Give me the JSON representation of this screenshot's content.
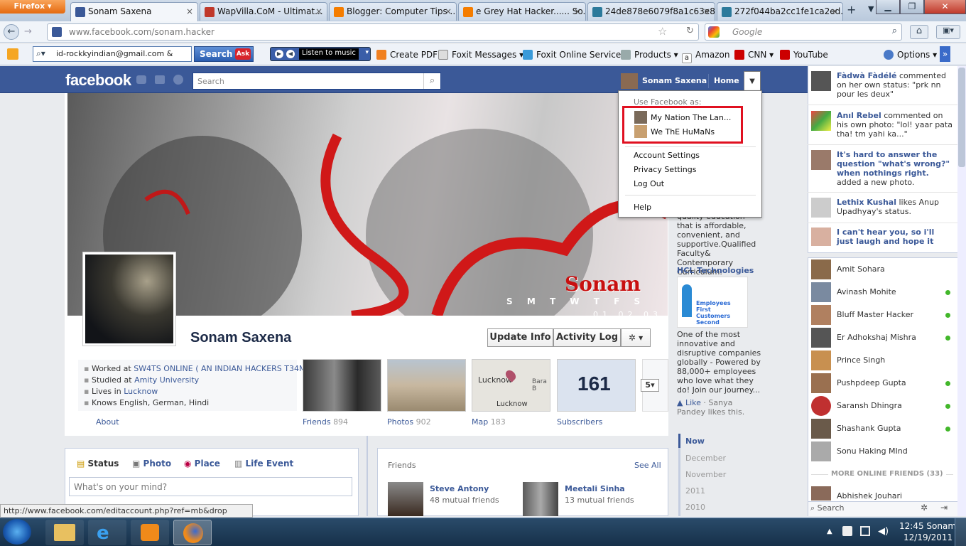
{
  "browser": {
    "menu_label": "Firefox",
    "tabs": [
      {
        "title": "Sonam Saxena",
        "active": true
      },
      {
        "title": "WapVilla.CoM - Ultimat..."
      },
      {
        "title": "Blogger: Computer Tips ..."
      },
      {
        "title": "e Grey Hat Hacker...... So..."
      },
      {
        "title": "24de878e6079f8a1c63e8..."
      },
      {
        "title": "272f044ba2cc1fe1ca2ed..."
      }
    ],
    "new_tab": "+",
    "url": "www.facebook.com/sonam.hacker",
    "search_placeholder": "Google",
    "toolbar_email": "id-rockkyindian@gmail.com &",
    "search_button": "Search",
    "listen_label": "Listen to music",
    "bookmarks": [
      "Create PDF",
      "Foxit Messages",
      "Foxit Online Services",
      "Products",
      "Amazon",
      "CNN",
      "YouTube"
    ],
    "options_label": "Options",
    "status_url": "http://www.facebook.com/editaccount.php?ref=mb&drop"
  },
  "fb": {
    "logo": "facebook",
    "search_placeholder": "Search",
    "user_name": "Sonam Saxena",
    "home_label": "Home",
    "dropdown": {
      "heading": "Use Facebook as:",
      "pages": [
        "My Nation The Lan...",
        "We ThE HuMaNs"
      ],
      "items": [
        "Account Settings",
        "Privacy Settings",
        "Log Out"
      ],
      "help": "Help"
    }
  },
  "profile": {
    "name": "Sonam Saxena",
    "cover_text": "Sonam",
    "calendar_days": "S M T W T F S",
    "calendar_dates": "01 02 03",
    "update_info": "Update Info",
    "activity_log": "Activity Log",
    "info": {
      "work_prefix": "Worked at ",
      "work": "SW4TS ONLINE ( AN INDIAN HACKERS T34M )",
      "study_prefix": "Studied at ",
      "study": "Amity University",
      "lives_prefix": "Lives in ",
      "lives": "Lucknow",
      "knows": "Knows English, German, Hindi"
    },
    "about": "About",
    "tiles": {
      "friends_label": "Friends",
      "friends_count": "894",
      "photos_label": "Photos",
      "photos_count": "902",
      "map_label": "Map",
      "map_count": "183",
      "subs_label": "Subscribers",
      "subs_count": "161",
      "map_city": "Lucknow",
      "map_city2": "Lucknow",
      "map_place": "Bara B",
      "more": "5"
    },
    "composer": {
      "status": "Status",
      "photo": "Photo",
      "place": "Place",
      "life_event": "Life Event",
      "placeholder": "What's on your mind?"
    },
    "friends_box": {
      "title": "Friends",
      "see_all": "See All",
      "friends": [
        {
          "name": "Steve Antony",
          "mutual": "48 mutual friends"
        },
        {
          "name": "Meetali Sinha",
          "mutual": "13 mutual friends"
        }
      ]
    }
  },
  "rail": {
    "ad1_text": "quality education that is affordable, convenient, and supportive.Qualified Faculty& Contemporary Curriculum.",
    "ad2_title": "HCL Technologies",
    "ad2_image_text": "Employees First Customers Second",
    "ad2_text": "One of the most innovative and disruptive companies globally - Powered by 88,000+ employees who love what they do! Join our journey...",
    "like": "Like",
    "like_suffix": " · Sanya Pandey likes this.",
    "timeline": [
      "Now",
      "December",
      "November",
      "2011",
      "2010"
    ]
  },
  "ticker": {
    "stories": [
      {
        "actor": "Fàdwà Fàdélé",
        "text": " commented on her own status: \"prk nn pour les deux\""
      },
      {
        "actor": "Anıl Rebel",
        "text": " commented on his own photo: \"lol! yaar pata tha! tm yahi ka...\""
      },
      {
        "actor": "It's hard to answer the question \"what's wrong?\" when nothings right.",
        "text": " added a new photo."
      },
      {
        "actor": "Lethix Kushal",
        "text": " likes Anup Upadhyay's status."
      },
      {
        "actor": "I can't hear you, so i'll just laugh and hope it wasn't a",
        "text": ""
      }
    ],
    "chat": [
      {
        "name": "Amit Sohara",
        "online": false
      },
      {
        "name": "Avinash Mohite",
        "online": true
      },
      {
        "name": "Bluff Master Hacker",
        "online": true
      },
      {
        "name": "Er Adhokshaj Mishra",
        "online": true
      },
      {
        "name": "Prince Singh",
        "online": false
      },
      {
        "name": "Pushpdeep Gupta",
        "online": true
      },
      {
        "name": "Saransh Dhingra",
        "online": true
      },
      {
        "name": "Shashank Gupta",
        "online": true
      },
      {
        "name": "Sonu Haking MInd",
        "online": false
      }
    ],
    "more_online": "MORE ONLINE FRIENDS (33)",
    "last_friend": "Abhishek Jouhari",
    "search_placeholder": "Search"
  },
  "taskbar": {
    "time": "12:45 Sonam",
    "date": "12/19/2011"
  }
}
